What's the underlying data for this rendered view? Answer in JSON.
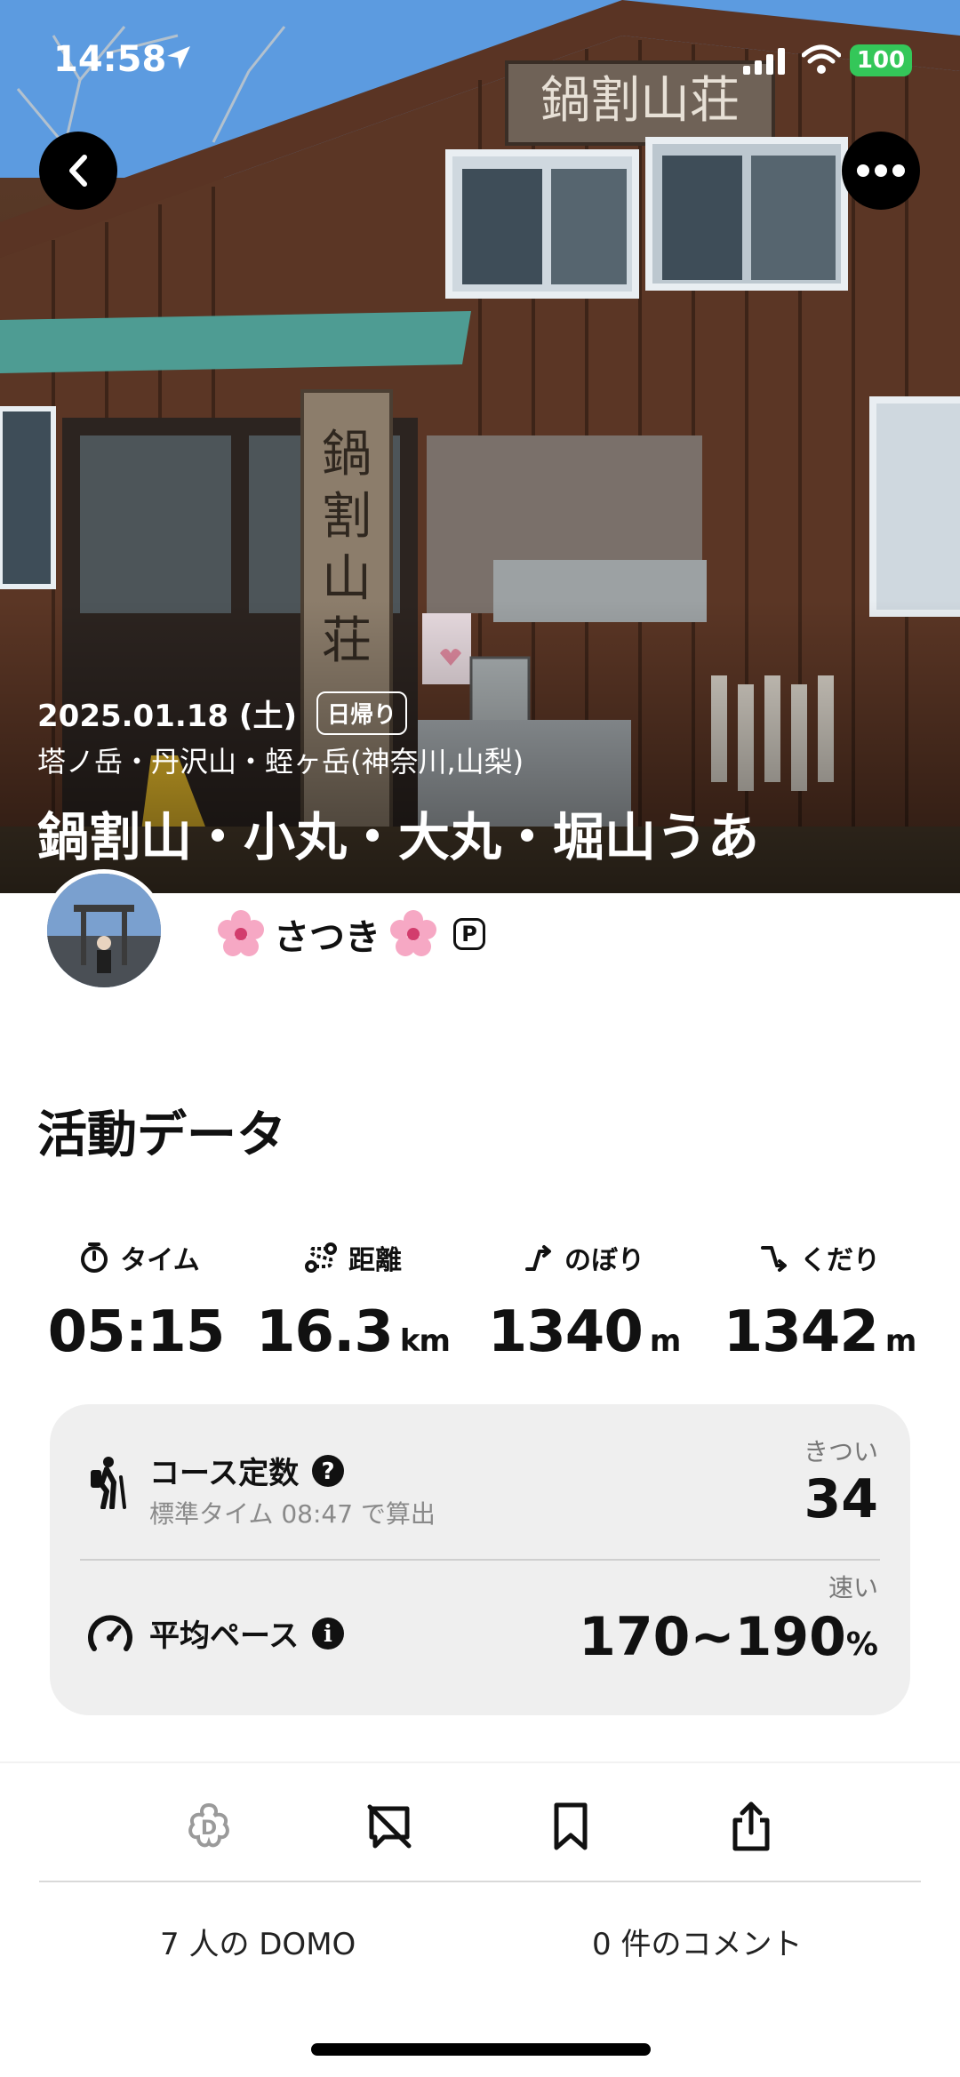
{
  "status": {
    "time": "14:58",
    "battery": "100"
  },
  "hero": {
    "date": "2025.01.18 (土)",
    "badge": "日帰り",
    "area": "塔ノ岳・丹沢山・蛭ヶ岳(神奈川,山梨)",
    "title": "鍋割山・小丸・大丸・堀山うあ",
    "signboard_text": "鍋割山荘",
    "post_text": "鍋割山荘"
  },
  "user": {
    "name": "さつき",
    "premium_badge": "P"
  },
  "activity": {
    "title": "活動データ",
    "stats": [
      {
        "label": "タイム",
        "value": "05:15",
        "unit": "",
        "icon": "stopwatch-icon"
      },
      {
        "label": "距離",
        "value": "16.3",
        "unit": "km",
        "icon": "route-icon"
      },
      {
        "label": "のぼり",
        "value": "1340",
        "unit": "m",
        "icon": "ascent-icon"
      },
      {
        "label": "くだり",
        "value": "1342",
        "unit": "m",
        "icon": "descent-icon"
      }
    ],
    "course": {
      "title": "コース定数",
      "subtitle": "標準タイム 08:47 で算出",
      "rating": "きつい",
      "value": "34"
    },
    "pace": {
      "title": "平均ペース",
      "rating": "速い",
      "value": "170~190",
      "unit": "%"
    }
  },
  "footer": {
    "domo_count": "7 人の DOMO",
    "comment_count": "0 件のコメント"
  },
  "colors": {
    "battery": "#34c759",
    "card_bg": "#efefef"
  }
}
